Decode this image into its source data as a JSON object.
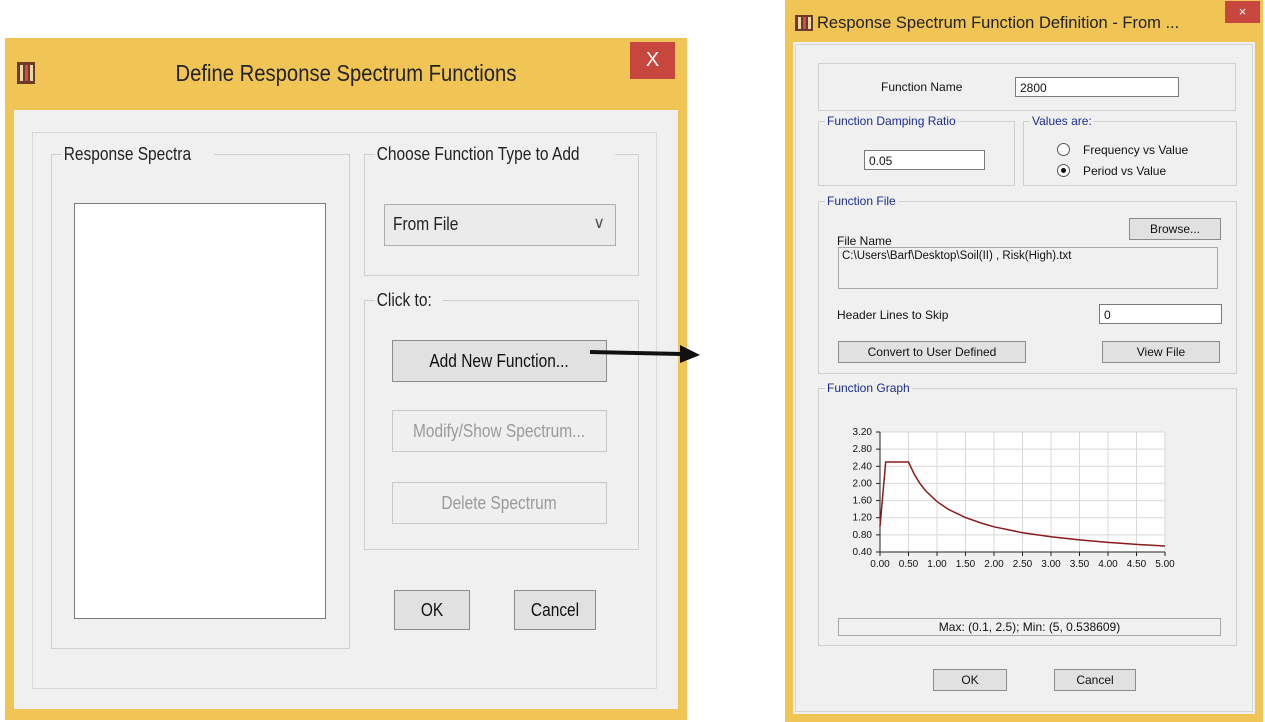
{
  "define_dialog": {
    "title": "Define Response Spectrum Functions",
    "close_label": "X",
    "response_spectra_label": "Response Spectra",
    "choose_type_label": "Choose  Function Type to Add",
    "function_type_selected": "From File",
    "click_to_label": "Click to:",
    "add_button": "Add New Function...",
    "modify_button": "Modify/Show Spectrum...",
    "delete_button": "Delete Spectrum",
    "ok_button": "OK",
    "cancel_button": "Cancel"
  },
  "function_dialog": {
    "title": "Response Spectrum Function Definition - From ...",
    "close_label": "×",
    "function_name_label": "Function Name",
    "function_name_value": "2800",
    "damping_group_label": "Function Damping Ratio",
    "damping_value": "0.05",
    "values_are_label": "Values are:",
    "radio_frequency": "Frequency vs Value",
    "radio_period": "Period vs Value",
    "selected_radio": "period",
    "function_file_label": "Function File",
    "browse_button": "Browse...",
    "file_name_label": "File Name",
    "file_name_value": "C:\\Users\\Barf\\Desktop\\Soil(II) , Risk(High).txt",
    "header_lines_label": "Header Lines to Skip",
    "header_lines_value": "0",
    "convert_button": "Convert to User Defined",
    "view_file_button": "View File",
    "function_graph_label": "Function Graph",
    "graph_summary": "Max: (0.1, 2.5);  Min: (5, 0.538609)",
    "ok_button": "OK",
    "cancel_button": "Cancel"
  },
  "chart_data": {
    "type": "line",
    "x_ticks": [
      "0.00",
      "0.50",
      "1.00",
      "1.50",
      "2.00",
      "2.50",
      "3.00",
      "3.50",
      "4.00",
      "4.50",
      "5.00"
    ],
    "y_ticks": [
      "0.40",
      "0.80",
      "1.20",
      "1.60",
      "2.00",
      "2.40",
      "2.80",
      "3.20"
    ],
    "xlim": [
      0,
      5
    ],
    "ylim": [
      0.4,
      3.2
    ],
    "grid": true,
    "series": [
      {
        "color": "#8b1a1a",
        "x": [
          0,
          0.1,
          0.5,
          0.6,
          0.7,
          0.8,
          1.0,
          1.2,
          1.5,
          1.8,
          2.0,
          2.5,
          3.0,
          3.5,
          4.0,
          4.5,
          5.0
        ],
        "y": [
          1.0,
          2.5,
          2.5,
          2.216,
          2.001,
          1.829,
          1.575,
          1.395,
          1.202,
          1.064,
          0.989,
          0.851,
          0.756,
          0.683,
          0.625,
          0.578,
          0.539
        ]
      }
    ]
  }
}
